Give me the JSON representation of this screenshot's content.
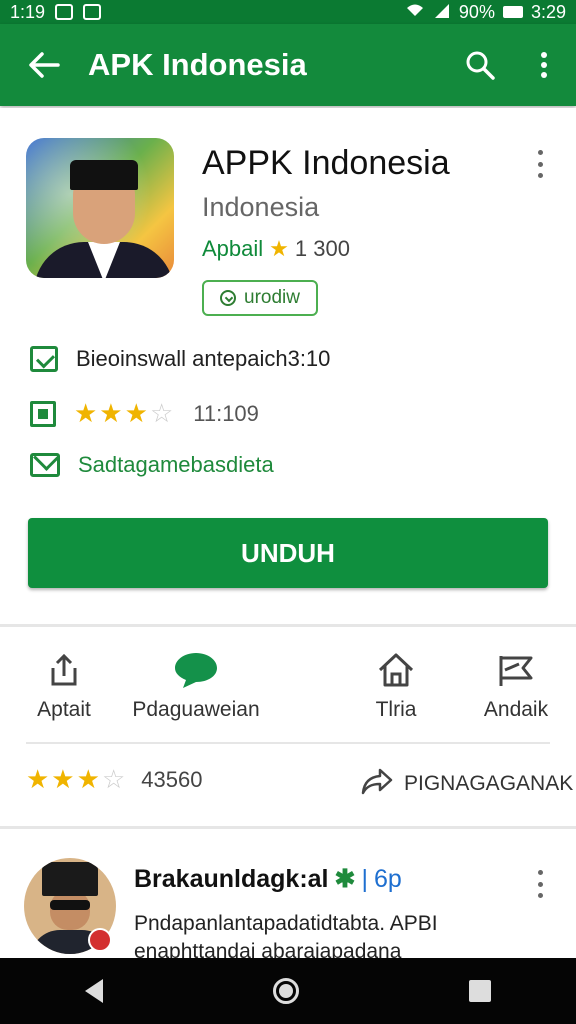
{
  "status_bar": {
    "time": "1:19",
    "battery_percent": "90%",
    "clock_right": "3:29"
  },
  "app_bar": {
    "title": "APK Indonesia",
    "back_icon": "arrow-back-icon",
    "search_icon": "search-icon",
    "menu_icon": "more-vert-icon"
  },
  "app": {
    "title": "APPK Indonesia",
    "developer": "Indonesia",
    "rating_label": "Apbail",
    "rating_value": "1 300",
    "badge_label": "urodiw"
  },
  "info_rows": [
    {
      "icon": "checkbox-icon",
      "text": "Bieoinswall antepaich3:10"
    },
    {
      "icon": "bookmark-icon",
      "stars": 3,
      "text": "11:109"
    },
    {
      "icon": "mail-icon",
      "text": "Sadtagamebasdieta"
    }
  ],
  "primary_button": {
    "label": "UNDUH"
  },
  "actions": [
    {
      "icon": "share-icon",
      "label": "Aptait"
    },
    {
      "icon": "chat-bubble-icon",
      "label": "Pdaguaweian"
    },
    {
      "icon": "home-icon",
      "label": "Tlria"
    },
    {
      "icon": "flag-icon",
      "label": "Andaik"
    }
  ],
  "rating_summary": {
    "stars": 3,
    "count": "43560"
  },
  "share_summary": {
    "icon": "forward-icon",
    "label": "PIGNAGAGANAK"
  },
  "review": {
    "name": "Brakaunldagk:al",
    "tag": "✱",
    "sep": "|",
    "extra": "6p",
    "text": "Pndapanlantapadatidtabta. APBI enaphttandai abaraiapadana"
  },
  "colors": {
    "primary": "#138a3c",
    "status_bar": "#0b7a32",
    "accent": "#0f8f3e",
    "star": "#f0b400"
  }
}
